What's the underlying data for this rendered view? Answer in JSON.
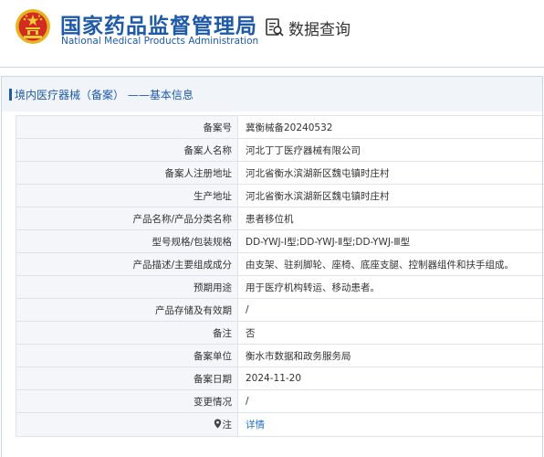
{
  "header": {
    "title_cn": "国家药品监督管理局",
    "title_en": "National Medical Products Administration",
    "query_label": "数据查询",
    "query_icon": "document-search-icon",
    "emblem_icon": "national-emblem-icon"
  },
  "panel": {
    "title": "境内医疗器械（备案） ——基本信息"
  },
  "rows": [
    {
      "label": "备案号",
      "value": "冀衡械备20240532"
    },
    {
      "label": "备案人名称",
      "value": "河北丁丁医疗器械有限公司"
    },
    {
      "label": "备案人注册地址",
      "value": "河北省衡水滨湖新区魏屯镇时庄村"
    },
    {
      "label": "生产地址",
      "value": "河北省衡水滨湖新区魏屯镇时庄村"
    },
    {
      "label": "产品名称/产品分类名称",
      "value": "患者移位机"
    },
    {
      "label": "型号规格/包装规格",
      "value": "DD-YWJ-Ⅰ型;DD-YWJ-Ⅱ型;DD-YWJ-Ⅲ型"
    },
    {
      "label": "产品描述/主要组成成分",
      "value": "由支架、驻刹脚轮、座椅、底座支腿、控制器组件和扶手组成。"
    },
    {
      "label": "预期用途",
      "value": "用于医疗机构转运、移动患者。"
    },
    {
      "label": "产品存储及有效期",
      "value": "/"
    },
    {
      "label": "备注",
      "value": "否"
    },
    {
      "label": "备案单位",
      "value": "衡水市数据和政务服务局"
    },
    {
      "label": "备案日期",
      "value": "2024-11-20"
    },
    {
      "label": "变更情况",
      "value": "/"
    },
    {
      "label": "注",
      "value": "详情",
      "icon": "location-pin-icon"
    }
  ],
  "colors": {
    "brand_blue": "#1f5aa8",
    "link_blue": "#1f6fd0",
    "emblem_red": "#d22b1f",
    "emblem_gold": "#e7b321"
  }
}
